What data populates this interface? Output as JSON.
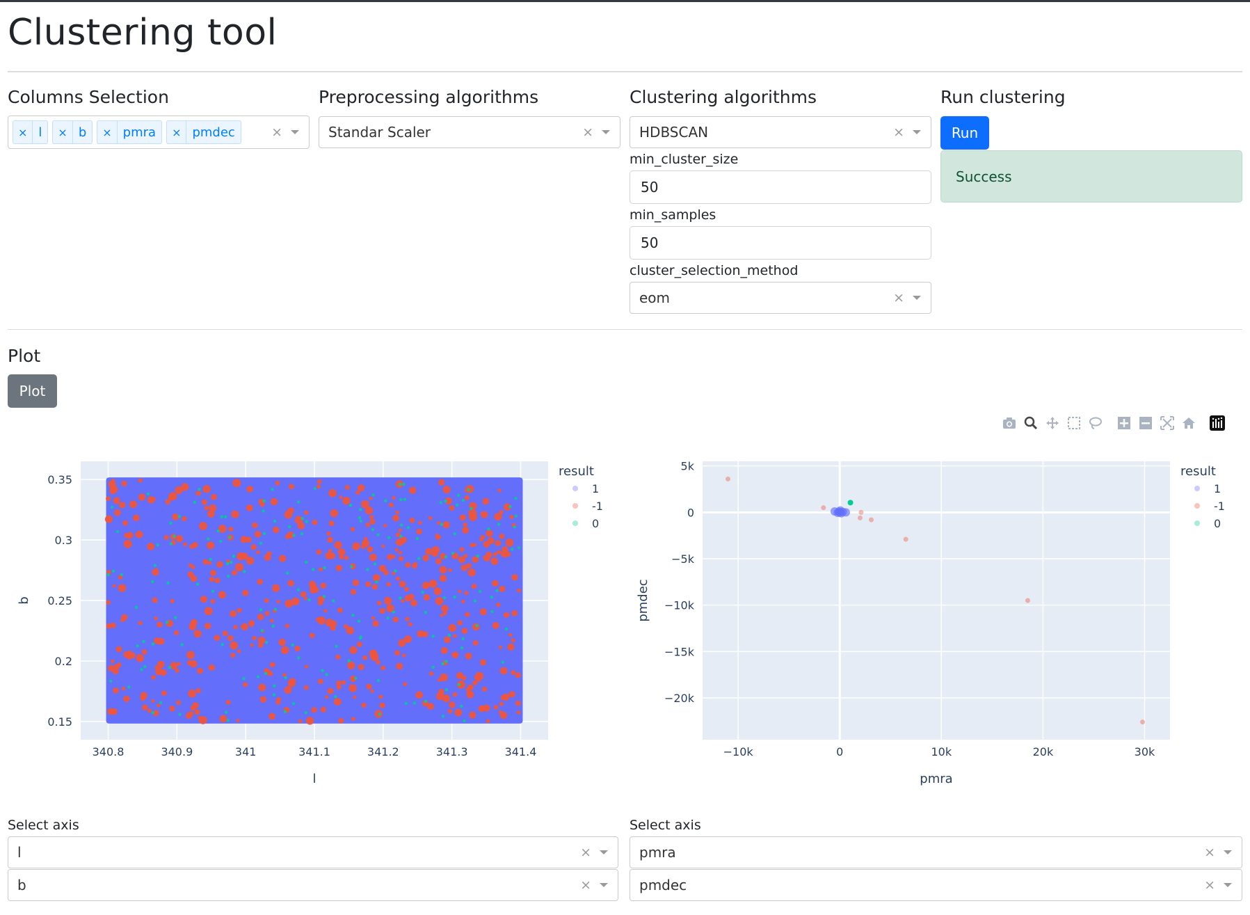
{
  "page": {
    "title": "Clustering tool"
  },
  "columns": {
    "title": "Columns Selection",
    "chips": [
      "l",
      "b",
      "pmra",
      "pmdec"
    ]
  },
  "preprocessing": {
    "title": "Preprocessing algorithms",
    "value": "Standar Scaler"
  },
  "clustering": {
    "title": "Clustering algorithms",
    "value": "HDBSCAN",
    "params": [
      {
        "label": "min_cluster_size",
        "value": "50"
      },
      {
        "label": "min_samples",
        "value": "50"
      }
    ],
    "method_label": "cluster_selection_method",
    "method_value": "eom"
  },
  "run": {
    "title": "Run clustering",
    "button": "Run",
    "status": "Success"
  },
  "plot": {
    "title": "Plot",
    "button": "Plot"
  },
  "modebar": [
    "camera-icon",
    "zoom-icon",
    "pan-icon",
    "box-select-icon",
    "lasso-icon",
    "zoom-in-icon",
    "zoom-out-icon",
    "autoscale-icon",
    "reset-axes-icon",
    "plotly-logo-icon"
  ],
  "chart_data": [
    {
      "type": "scatter",
      "xlabel": "l",
      "ylabel": "b",
      "xlim": [
        340.76,
        341.44
      ],
      "ylim": [
        0.135,
        0.365
      ],
      "xticks": [
        "340.8",
        "340.9",
        "341",
        "341.1",
        "341.2",
        "341.3",
        "341.4"
      ],
      "xtick_values": [
        340.8,
        340.9,
        341,
        341.1,
        341.2,
        341.3,
        341.4
      ],
      "yticks": [
        "0.15",
        "0.2",
        "0.25",
        "0.3",
        "0.35"
      ],
      "ytick_values": [
        0.15,
        0.2,
        0.25,
        0.3,
        0.35
      ],
      "legend_title": "result",
      "series": [
        {
          "name": "1",
          "color": "#636efa",
          "fill_region": {
            "x": [
              340.8,
              341.4
            ],
            "y": [
              0.15,
              0.35
            ]
          }
        },
        {
          "name": "-1",
          "color": "#ef553b"
        },
        {
          "name": "0",
          "color": "#00cc96"
        }
      ]
    },
    {
      "type": "scatter",
      "xlabel": "pmra",
      "ylabel": "pmdec",
      "xlim": [
        -13500,
        32500
      ],
      "ylim": [
        -24500,
        5500
      ],
      "xticks": [
        "−10k",
        "0",
        "10k",
        "20k",
        "30k"
      ],
      "xtick_values": [
        -10000,
        0,
        10000,
        20000,
        30000
      ],
      "yticks": [
        "5k",
        "0",
        "−5k",
        "−10k",
        "−15k",
        "−20k"
      ],
      "ytick_values": [
        5000,
        0,
        -5000,
        -10000,
        -15000,
        -20000
      ],
      "legend_title": "result",
      "series": [
        {
          "name": "1",
          "color": "#636efa",
          "points": [
            [
              0,
              0
            ],
            [
              150,
              -100
            ],
            [
              -100,
              80
            ],
            [
              50,
              200
            ],
            [
              -200,
              -50
            ],
            [
              300,
              50
            ],
            [
              -500,
              100
            ],
            [
              600,
              0
            ]
          ]
        },
        {
          "name": "-1",
          "color": "#ef553b",
          "points": [
            [
              -11000,
              3600
            ],
            [
              -1600,
              500
            ],
            [
              2000,
              -600
            ],
            [
              2100,
              0
            ],
            [
              3100,
              -800
            ],
            [
              6500,
              -2900
            ],
            [
              18500,
              -9500
            ],
            [
              29800,
              -22600
            ]
          ]
        },
        {
          "name": "0",
          "color": "#00cc96",
          "points": [
            [
              1050,
              1050
            ]
          ]
        }
      ]
    }
  ],
  "axis_select": {
    "left": {
      "label": "Select axis",
      "x": "l",
      "y": "b"
    },
    "right": {
      "label": "Select axis",
      "x": "pmra",
      "y": "pmdec"
    }
  }
}
